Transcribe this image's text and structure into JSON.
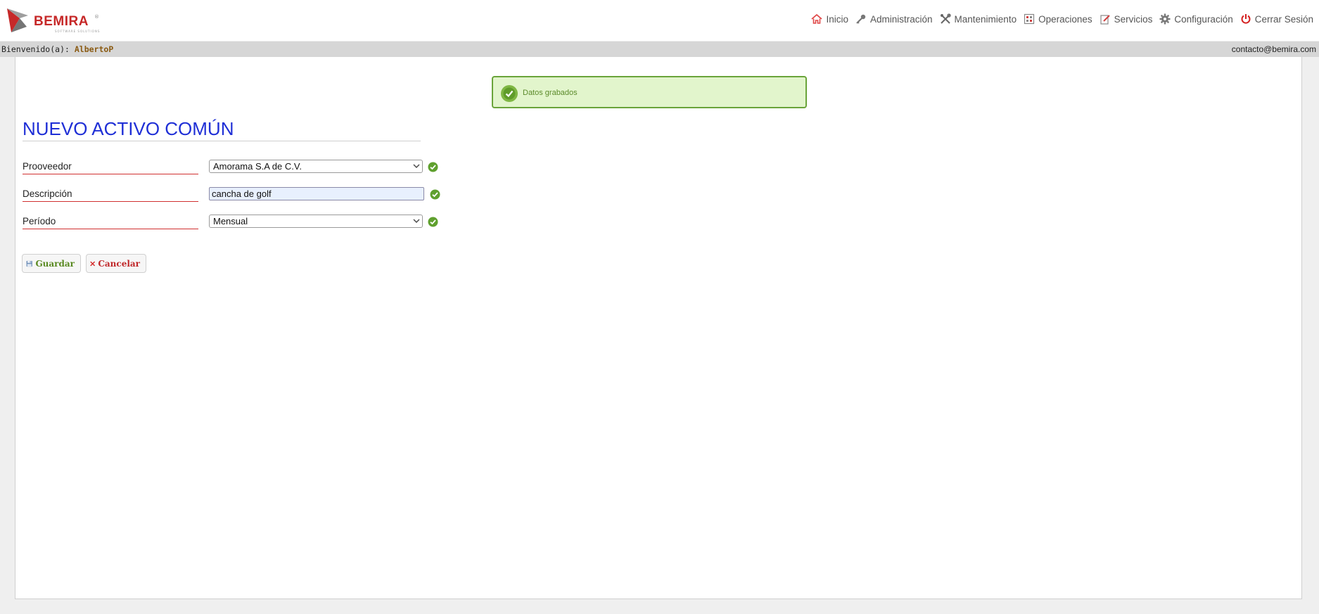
{
  "header": {
    "logo_text": "BEMIRA",
    "logo_tagline": "SOFTWARE SOLUTIONS",
    "nav": [
      {
        "label": "Inicio",
        "icon": "home-icon"
      },
      {
        "label": "Administración",
        "icon": "key-icon"
      },
      {
        "label": "Mantenimiento",
        "icon": "tools-icon"
      },
      {
        "label": "Operaciones",
        "icon": "grid-icon"
      },
      {
        "label": "Servicios",
        "icon": "edit-icon"
      },
      {
        "label": "Configuración",
        "icon": "gear-icon"
      },
      {
        "label": "Cerrar Sesión",
        "icon": "power-icon"
      }
    ]
  },
  "welcome": {
    "prefix": "Bienvenido(a): ",
    "user": "AlbertoP",
    "email": "contacto@bemira.com"
  },
  "alert": {
    "message": "Datos grabados",
    "color": "#6aa43a"
  },
  "page": {
    "title": "NUEVO ACTIVO COMÚN"
  },
  "form": {
    "proveedor": {
      "label": "Prooveedor",
      "value": "Amorama S.A de C.V."
    },
    "descripcion": {
      "label": "Descripción",
      "value": "cancha de golf"
    },
    "periodo": {
      "label": "Período",
      "value": "Mensual"
    }
  },
  "buttons": {
    "save": "Guardar",
    "cancel": "Cancelar"
  },
  "colors": {
    "title": "#1f2fd6",
    "label_underline": "#d03030",
    "brand": "#c62828"
  }
}
